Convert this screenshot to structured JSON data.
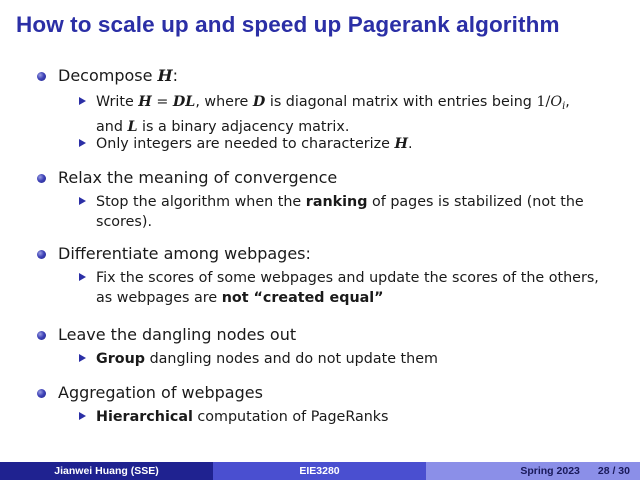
{
  "slide": {
    "title": "How to scale up and speed up Pagerank algorithm"
  },
  "items": [
    {
      "label_pre": "Decompose ",
      "label_math": "H",
      "label_post": ":",
      "subs": [
        {
          "part1": "Write ",
          "math_h": "H",
          "eq": " = ",
          "math_dl": "DL",
          "part2": ", where ",
          "math_d": "D",
          "part3": " is diagonal matrix with entries being ",
          "frac_num": "1/",
          "frac_o": "O",
          "frac_sub": "i",
          "part4": ",",
          "line2_pre": "and ",
          "math_l": "L",
          "line2_post": " is a binary adjacency matrix."
        },
        {
          "text_pre": "Only integers are needed to characterize ",
          "math": "H",
          "text_post": "."
        }
      ]
    },
    {
      "label": "Relax the meaning of convergence",
      "subs": [
        {
          "line1_pre": "Stop the algorithm when the ",
          "bold": "ranking",
          "line1_post": " of pages is stabilized (not the",
          "line2": "scores)."
        }
      ]
    },
    {
      "label": "Differentiate among webpages:",
      "subs": [
        {
          "line1": "Fix the scores of some webpages and update the scores of the others,",
          "line2_pre": "as webpages are ",
          "bold": "not “created equal”"
        }
      ]
    },
    {
      "label": "Leave the dangling nodes out",
      "subs": [
        {
          "bold": "Group",
          "text": " dangling nodes and do not update them"
        }
      ]
    },
    {
      "label": "Aggregation of webpages",
      "subs": [
        {
          "bold": "Hierarchical",
          "text": " computation of PageRanks"
        }
      ]
    }
  ],
  "footer": {
    "author": "Jianwei Huang  (SSE)",
    "course": "EIE3280",
    "date": "Spring 2023",
    "page": "28 / 30"
  },
  "colors": {
    "title": "#2b2fa6",
    "bullet": "#3f43b8",
    "footer_dark": "#1f2290",
    "footer_mid": "#4a4fd0",
    "footer_light": "#8b8fe8"
  },
  "icons": {
    "level1_bullet": "ball-bullet-icon",
    "level2_bullet": "triangle-bullet-icon"
  }
}
